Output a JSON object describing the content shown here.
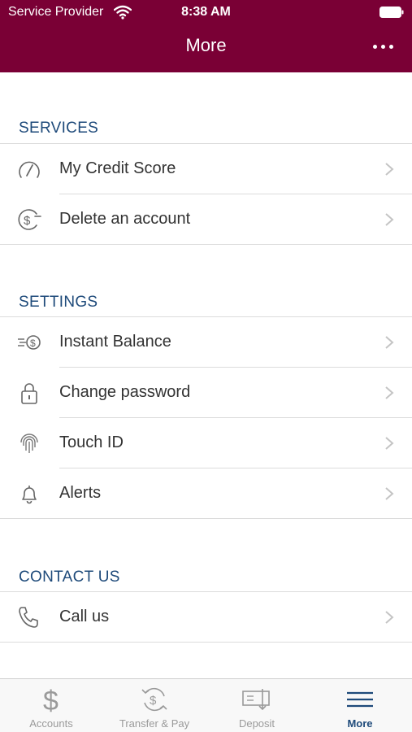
{
  "status_bar": {
    "carrier": "Service Provider",
    "time": "8:38 AM"
  },
  "nav": {
    "title": "More"
  },
  "services": {
    "title": "SERVICES",
    "items": [
      {
        "label": "My Credit Score",
        "icon": "gauge-icon"
      },
      {
        "label": "Delete an account",
        "icon": "dollar-minus-icon"
      }
    ]
  },
  "settings": {
    "title": "SETTINGS",
    "items": [
      {
        "label": "Instant Balance",
        "icon": "fast-dollar-icon"
      },
      {
        "label": "Change password",
        "icon": "lock-icon"
      },
      {
        "label": "Touch ID",
        "icon": "fingerprint-icon"
      },
      {
        "label": "Alerts",
        "icon": "bell-icon"
      }
    ]
  },
  "contact": {
    "title": "CONTACT US",
    "items": [
      {
        "label": "Call us",
        "icon": "phone-icon"
      }
    ]
  },
  "tabbar": {
    "accent": "#1e4a7a",
    "tabs": [
      {
        "label": "Accounts",
        "icon": "dollar-icon"
      },
      {
        "label": "Transfer & Pay",
        "icon": "transfer-icon"
      },
      {
        "label": "Deposit",
        "icon": "check-deposit-icon"
      },
      {
        "label": "More",
        "icon": "menu-icon",
        "active": true
      }
    ]
  },
  "colors": {
    "brand": "#7a0035",
    "section_title": "#1e4a7a"
  }
}
